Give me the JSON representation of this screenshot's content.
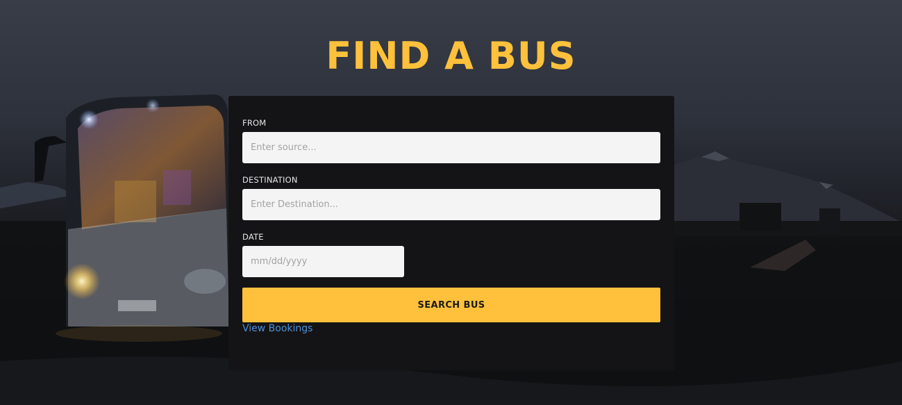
{
  "page": {
    "title": "FIND A BUS"
  },
  "form": {
    "from_label": "FROM",
    "from_placeholder": "Enter source...",
    "destination_label": "DESTINATION",
    "destination_placeholder": "Enter Destination...",
    "date_label": "DATE",
    "date_placeholder": "mm/dd/yyyy",
    "search_button": "SEARCH BUS",
    "view_bookings": "View Bookings"
  },
  "colors": {
    "accent": "#ffc13b",
    "panel": "#141416",
    "link": "#4c8fd6"
  }
}
